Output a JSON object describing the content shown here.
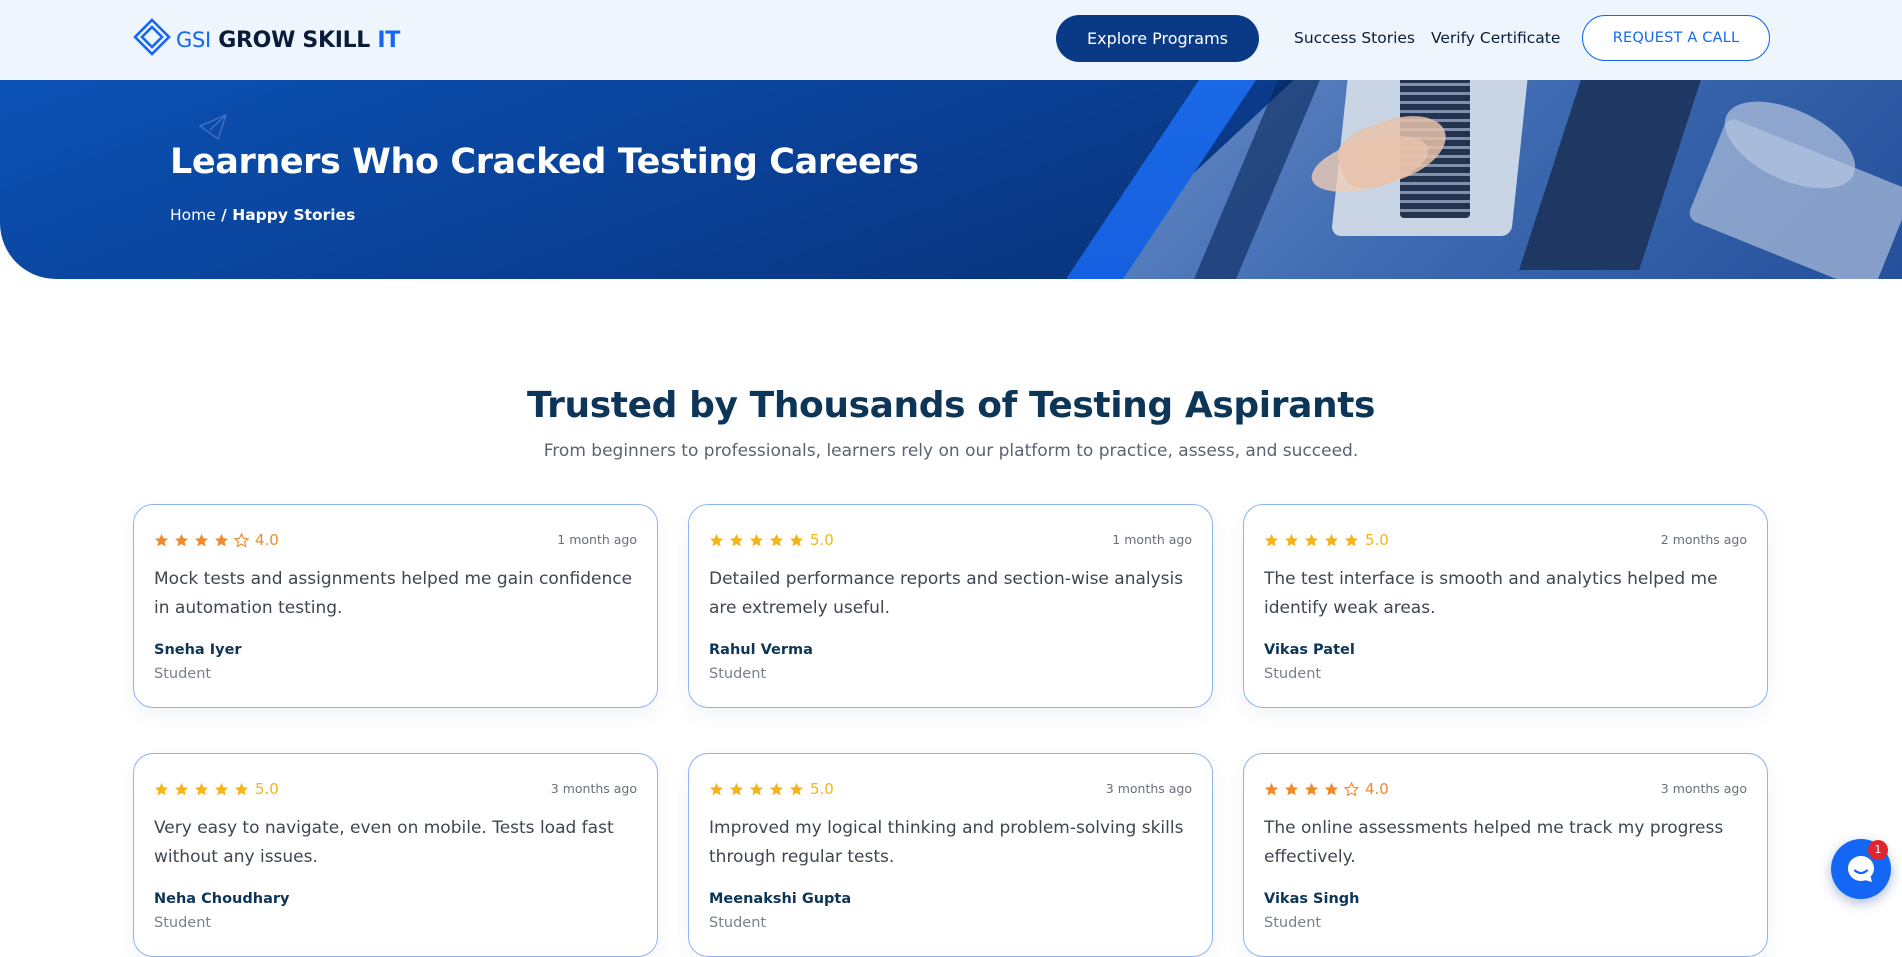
{
  "colors": {
    "brand_blue": "#1466f5",
    "navy": "#0a3a86",
    "heading": "#0d3558",
    "star_orange": "#f08a2c",
    "star_yellow": "#f4b41a",
    "card_border": "#8fb2f2"
  },
  "header": {
    "logo": {
      "gsi": "GSI",
      "grow": "GROW",
      "skill": " SKILL ",
      "it": "IT"
    },
    "explore_label": "Explore Programs",
    "success_label": "Success Stories",
    "verify_label": "Verify Certificate",
    "call_label": "REQUEST A CALL"
  },
  "hero": {
    "title": "Learners Who Cracked Testing Careers",
    "breadcrumb_home": "Home",
    "breadcrumb_sep": " / ",
    "breadcrumb_current": "Happy Stories"
  },
  "section": {
    "title": "Trusted by Thousands of Testing Aspirants",
    "subtitle": "From beginners to professionals, learners rely on our platform to practice, assess, and succeed."
  },
  "reviews": [
    {
      "rating": 4,
      "rating_label": "4.0",
      "date": "1 month ago",
      "text": "Mock tests and assignments helped me gain confidence in automation testing.",
      "name": "Sneha Iyer",
      "role": "Student",
      "star_color": "#f08a2c"
    },
    {
      "rating": 5,
      "rating_label": "5.0",
      "date": "1 month ago",
      "text": "Detailed performance reports and section-wise analysis are extremely useful.",
      "name": "Rahul Verma",
      "role": "Student",
      "star_color": "#f4b41a"
    },
    {
      "rating": 5,
      "rating_label": "5.0",
      "date": "2 months ago",
      "text": "The test interface is smooth and analytics helped me identify weak areas.",
      "name": "Vikas Patel",
      "role": "Student",
      "star_color": "#f4b41a"
    },
    {
      "rating": 5,
      "rating_label": "5.0",
      "date": "3 months ago",
      "text": "Very easy to navigate, even on mobile. Tests load fast without any issues.",
      "name": "Neha Choudhary",
      "role": "Student",
      "star_color": "#f4b41a"
    },
    {
      "rating": 5,
      "rating_label": "5.0",
      "date": "3 months ago",
      "text": "Improved my logical thinking and problem-solving skills through regular tests.",
      "name": "Meenakshi Gupta",
      "role": "Student",
      "star_color": "#f4b41a"
    },
    {
      "rating": 4,
      "rating_label": "4.0",
      "date": "3 months ago",
      "text": "The online assessments helped me track my progress effectively.",
      "name": "Vikas Singh",
      "role": "Student",
      "star_color": "#f08a2c"
    }
  ],
  "chat": {
    "icon": "chat-bubble-icon",
    "badge": "1"
  }
}
